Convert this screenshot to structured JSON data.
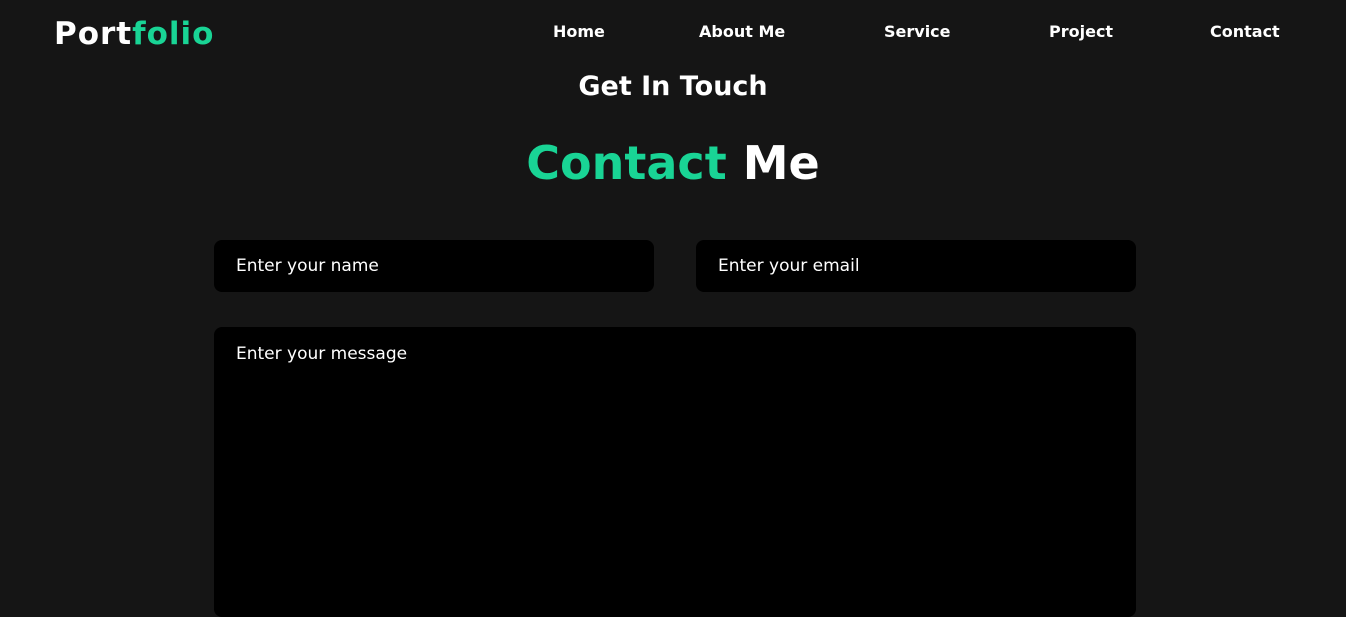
{
  "logo": {
    "text_plain": "Port",
    "text_accent": "folio"
  },
  "nav": {
    "items": [
      {
        "label": "Home"
      },
      {
        "label": "About Me"
      },
      {
        "label": "Service"
      },
      {
        "label": "Project"
      },
      {
        "label": "Contact"
      }
    ]
  },
  "section": {
    "subtitle": "Get In Touch",
    "title_accent": "Contact",
    "title_plain": "Me"
  },
  "form": {
    "name_placeholder": "Enter your name",
    "email_placeholder": "Enter your email",
    "message_placeholder": "Enter your message"
  },
  "colors": {
    "background": "#151515",
    "accent": "#19d495",
    "field_background": "#000000",
    "text": "#ffffff"
  }
}
